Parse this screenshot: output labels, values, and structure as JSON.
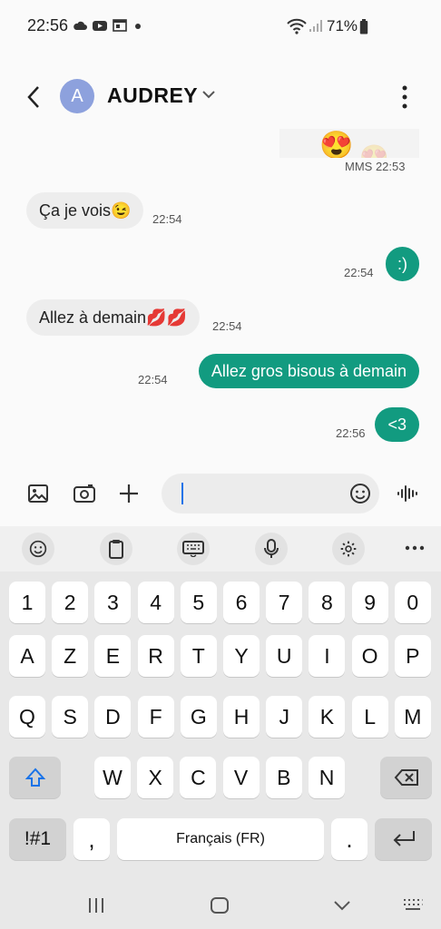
{
  "status_bar": {
    "time": "22:56",
    "battery": "71%"
  },
  "header": {
    "avatar_letter": "A",
    "contact_name": "AUDREY"
  },
  "messages": [
    {
      "dir": "out",
      "type": "MMS",
      "time": "MMS 22:53",
      "content": "😍"
    },
    {
      "dir": "in",
      "text": "Ça je vois😉",
      "time": "22:54"
    },
    {
      "dir": "out",
      "text": ":)",
      "time": "22:54"
    },
    {
      "dir": "in",
      "text": "Allez à demain💋💋",
      "time": "22:54"
    },
    {
      "dir": "out",
      "text": "Allez gros bisous à demain",
      "time": "22:54"
    },
    {
      "dir": "out",
      "text": "<3",
      "time": "22:56"
    }
  ],
  "composer": {
    "input_value": ""
  },
  "keyboard": {
    "row_numbers": [
      "1",
      "2",
      "3",
      "4",
      "5",
      "6",
      "7",
      "8",
      "9",
      "0"
    ],
    "row1": [
      "A",
      "Z",
      "E",
      "R",
      "T",
      "Y",
      "U",
      "I",
      "O",
      "P"
    ],
    "row2": [
      "Q",
      "S",
      "D",
      "F",
      "G",
      "H",
      "J",
      "K",
      "L",
      "M"
    ],
    "row3": [
      "W",
      "X",
      "C",
      "V",
      "B",
      "N"
    ],
    "symbols_key": "!#1",
    "comma_key": ",",
    "space_label": "Français (FR)",
    "period_key": "."
  },
  "colors": {
    "accent": "#129b80",
    "avatar": "#8da1dd",
    "incoming_bubble": "#ededed"
  },
  "icons": [
    "cloud-icon",
    "youtube-icon",
    "calendar-icon",
    "wifi-icon",
    "signal-icon",
    "battery-icon",
    "gallery-icon",
    "camera-icon",
    "plus-icon",
    "emoji-icon",
    "voice-icon",
    "clipboard-icon",
    "keyboard-icon",
    "mic-icon",
    "settings-icon",
    "more-icon",
    "shift-icon",
    "backspace-icon",
    "enter-icon",
    "recents-icon",
    "home-icon",
    "back-nav-icon",
    "keyboard-hide-icon"
  ]
}
